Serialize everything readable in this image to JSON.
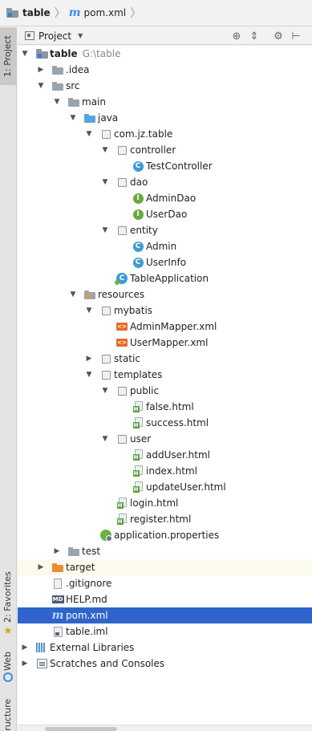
{
  "breadcrumb": {
    "project": "table",
    "file": "pom.xml"
  },
  "tool_strip": {
    "project_tab": "1: Project",
    "favorites_tab": "2: Favorites",
    "web_tab": "Web",
    "structure_tab": "Structure"
  },
  "panel": {
    "title": "Project",
    "tools": [
      "target-icon",
      "collapse-icon",
      "gear-icon",
      "hide-icon"
    ]
  },
  "tree": {
    "root_label": "table",
    "root_path": "G:\\table",
    "items": [
      {
        "label": "table",
        "icon": "module-folder-icon"
      },
      {
        "label": ".idea",
        "icon": "folder-icon"
      },
      {
        "label": "src",
        "icon": "folder-icon"
      },
      {
        "label": "main",
        "icon": "folder-icon"
      },
      {
        "label": "java",
        "icon": "source-folder-icon"
      },
      {
        "label": "com.jz.table",
        "icon": "package-icon"
      },
      {
        "label": "controller",
        "icon": "package-icon"
      },
      {
        "label": "TestController",
        "icon": "class-icon"
      },
      {
        "label": "dao",
        "icon": "package-icon"
      },
      {
        "label": "AdminDao",
        "icon": "interface-icon"
      },
      {
        "label": "UserDao",
        "icon": "interface-icon"
      },
      {
        "label": "entity",
        "icon": "package-icon"
      },
      {
        "label": "Admin",
        "icon": "class-icon"
      },
      {
        "label": "UserInfo",
        "icon": "class-icon"
      },
      {
        "label": "TableApplication",
        "icon": "spring-app-icon"
      },
      {
        "label": "resources",
        "icon": "resources-folder-icon"
      },
      {
        "label": "mybatis",
        "icon": "package-icon"
      },
      {
        "label": "AdminMapper.xml",
        "icon": "xml-icon"
      },
      {
        "label": "UserMapper.xml",
        "icon": "xml-icon"
      },
      {
        "label": "static",
        "icon": "package-icon"
      },
      {
        "label": "templates",
        "icon": "package-icon"
      },
      {
        "label": "public",
        "icon": "package-icon"
      },
      {
        "label": "false.html",
        "icon": "html-icon"
      },
      {
        "label": "success.html",
        "icon": "html-icon"
      },
      {
        "label": "user",
        "icon": "package-icon"
      },
      {
        "label": "addUser.html",
        "icon": "html-icon"
      },
      {
        "label": "index.html",
        "icon": "html-icon"
      },
      {
        "label": "updateUser.html",
        "icon": "html-icon"
      },
      {
        "label": "login.html",
        "icon": "html-icon"
      },
      {
        "label": "register.html",
        "icon": "html-icon"
      },
      {
        "label": "application.properties",
        "icon": "spring-properties-icon"
      },
      {
        "label": "test",
        "icon": "folder-icon"
      },
      {
        "label": "target",
        "icon": "excluded-folder-icon"
      },
      {
        "label": ".gitignore",
        "icon": "file-icon"
      },
      {
        "label": "HELP.md",
        "icon": "markdown-icon"
      },
      {
        "label": "pom.xml",
        "icon": "maven-icon"
      },
      {
        "label": "table.iml",
        "icon": "iml-icon"
      },
      {
        "label": "External Libraries",
        "icon": "library-icon"
      },
      {
        "label": "Scratches and Consoles",
        "icon": "scratch-icon"
      }
    ]
  }
}
